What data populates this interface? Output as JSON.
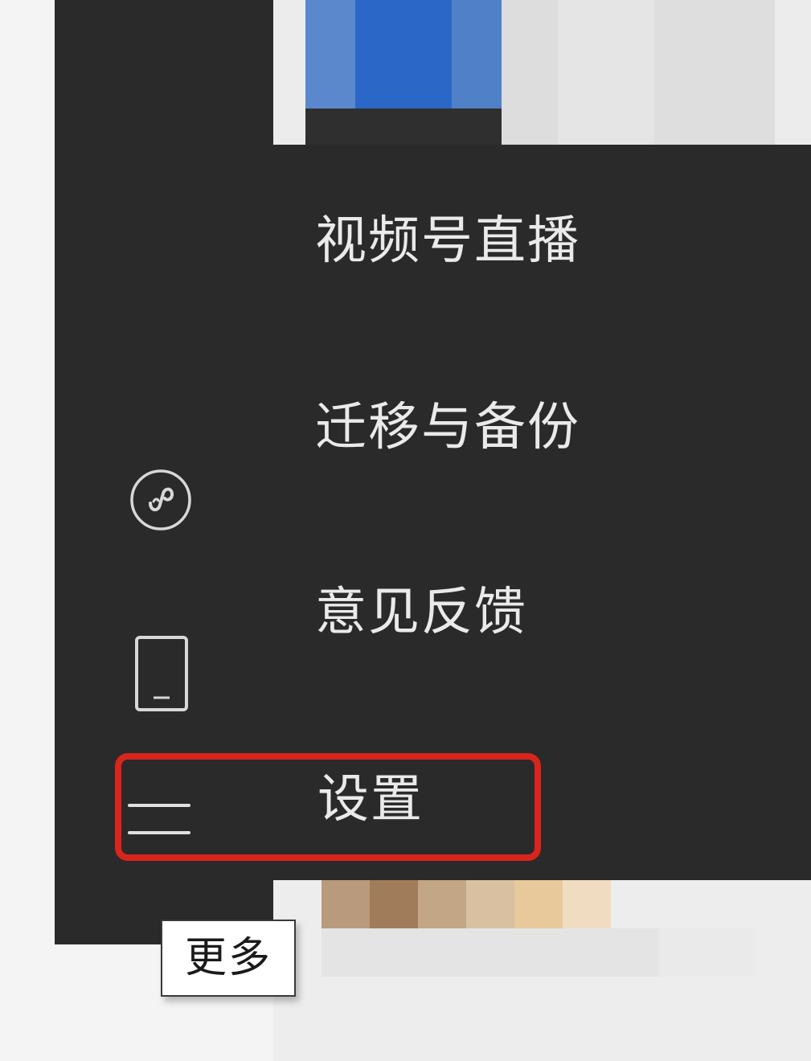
{
  "menu": {
    "items": [
      {
        "label": "视频号直播"
      },
      {
        "label": "迁移与备份"
      },
      {
        "label": "意见反馈"
      },
      {
        "label": "设置"
      }
    ]
  },
  "sidebar": {
    "icons": [
      "mini-program-icon",
      "phone-icon",
      "menu-icon"
    ]
  },
  "tooltip": {
    "label": "更多"
  },
  "colors": {
    "panel_bg": "#2a2a2a",
    "menu_text": "#eaeaea",
    "highlight": "#d9251d",
    "tooltip_bg": "#ffffff"
  }
}
